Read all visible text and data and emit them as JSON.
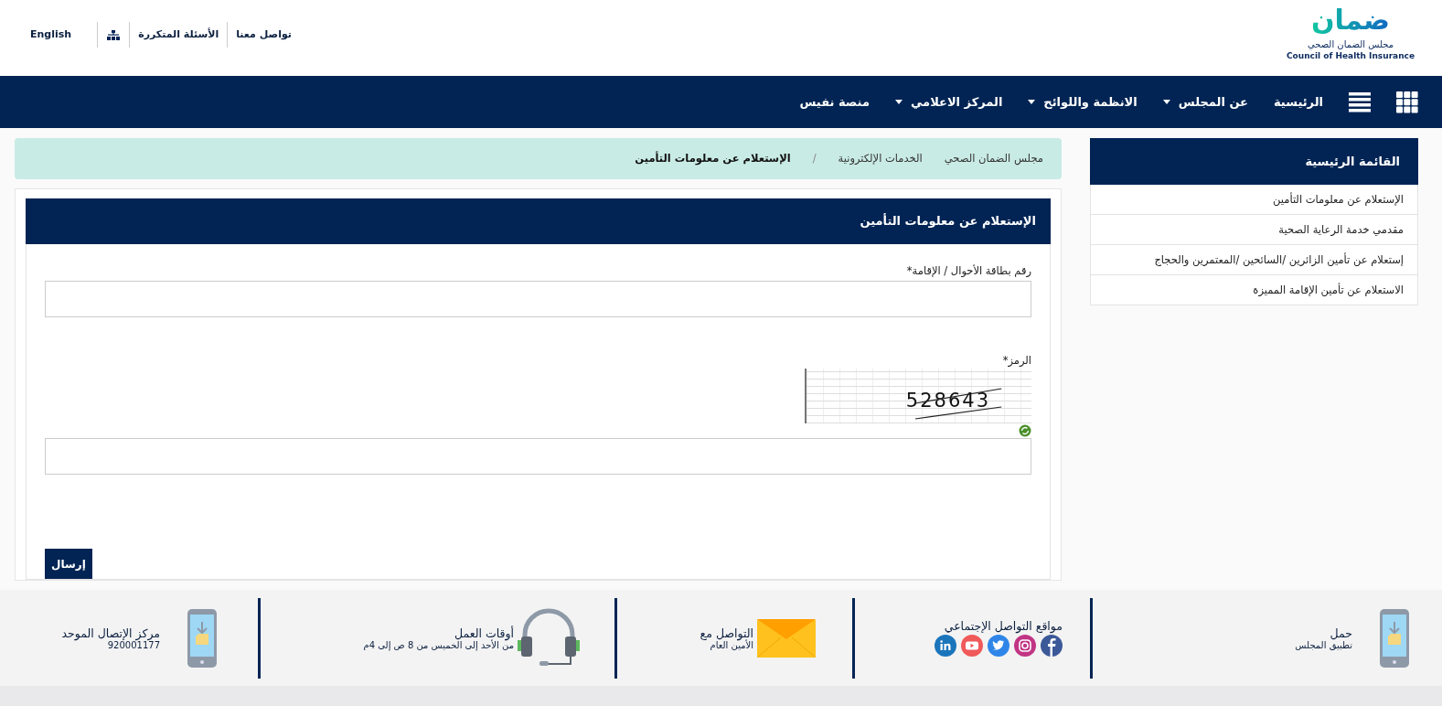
{
  "logo": {
    "mark": "ضمان",
    "name_ar": "مجلس الضمان الصحي",
    "name_en": "Council of Health Insurance"
  },
  "top_links": [
    {
      "kind": "text",
      "label": "تواصل معنا"
    },
    {
      "kind": "text",
      "label": "الأسئلة المتكررة"
    },
    {
      "kind": "sitemap"
    },
    {
      "kind": "text",
      "label": "English"
    }
  ],
  "nav": [
    {
      "label": "الرئيسية",
      "dropdown": false
    },
    {
      "label": "عن المجلس",
      "dropdown": true
    },
    {
      "label": "الانظمة واللوائح",
      "dropdown": true
    },
    {
      "label": "المركز الاعلامي",
      "dropdown": true
    },
    {
      "label": "منصة نفيس",
      "dropdown": false
    }
  ],
  "sidebar": {
    "title": "القائمة الرئيسية",
    "items": [
      "الإستعلام عن معلومات التأمين",
      "مقدمي خدمة الرعاية الصحية",
      "إستعلام عن تأمين الزائرين /السائحين /المعتمرين والحجاج",
      "الاستعلام عن تأمين الإقامة المميزة"
    ]
  },
  "breadcrumbs": [
    {
      "kind": "link",
      "label": "مجلس الضمان الصحي"
    },
    {
      "kind": "link",
      "label": "الخدمات الإلكترونية"
    },
    {
      "kind": "separator",
      "label": "/"
    },
    {
      "kind": "current",
      "label": "الإستعلام عن معلومات التأمين"
    }
  ],
  "form": {
    "title": "الإستعلام عن معلومات التأمين",
    "id_label": "رقم بطاقة الأحوال / الإقامة*",
    "code_label": "الرمز*",
    "captcha": "528643",
    "submit": "إرسال"
  },
  "footer": [
    {
      "kind": "phone",
      "title": "حمل",
      "subtitle": "تطبيق المجلس"
    },
    {
      "kind": "social",
      "title": "مواقع التواصل الإجتماعي"
    },
    {
      "kind": "mail",
      "title": "التواصل مع",
      "subtitle": "الأمين العام"
    },
    {
      "kind": "headset",
      "title": "أوقات العمل",
      "subtitle": "من الأحد إلى الخميس من 8 ص إلى 4م"
    },
    {
      "kind": "phone",
      "title": "مركز الإتصال الموحد",
      "subtitle": "920001177"
    }
  ]
}
